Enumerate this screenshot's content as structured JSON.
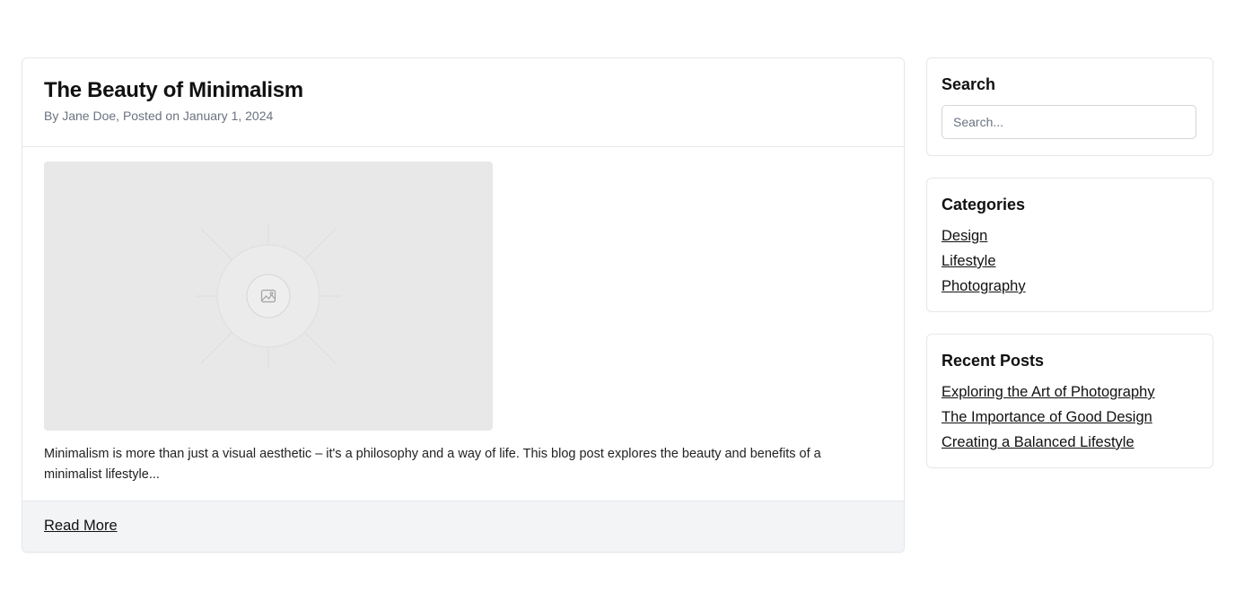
{
  "post": {
    "title": "The Beauty of Minimalism",
    "meta": "By Jane Doe, Posted on January 1, 2024",
    "image_icon": "image-placeholder-icon",
    "excerpt": "Minimalism is more than just a visual aesthetic – it's a philosophy and a way of life. This blog post explores the beauty and benefits of a minimalist lifestyle...",
    "read_more_label": "Read More"
  },
  "sidebar": {
    "search": {
      "title": "Search",
      "placeholder": "Search..."
    },
    "categories": {
      "title": "Categories",
      "items": [
        "Design",
        "Lifestyle",
        "Photography"
      ]
    },
    "recent_posts": {
      "title": "Recent Posts",
      "items": [
        "Exploring the Art of Photography",
        "The Importance of Good Design",
        "Creating a Balanced Lifestyle"
      ]
    }
  },
  "colors": {
    "border": "#e5e7eb",
    "muted_text": "#6b7280",
    "footer_bg": "#f3f4f6",
    "image_bg": "#e8e8e8"
  }
}
